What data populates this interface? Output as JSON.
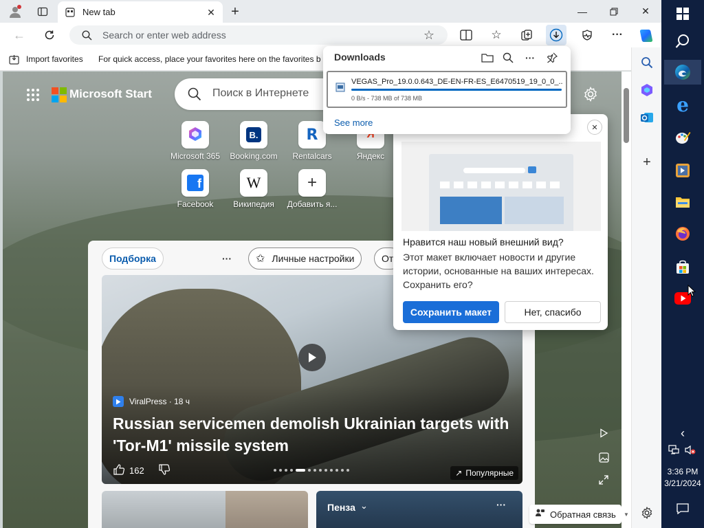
{
  "browser": {
    "tab_title": "New tab",
    "address_placeholder": "Search or enter web address",
    "favorites": {
      "import_label": "Import favorites",
      "hint": "For quick access, place your favorites here on the favorites b"
    }
  },
  "downloads": {
    "title": "Downloads",
    "item": {
      "filename": "VEGAS_Pro_19.0.0.643_DE-EN-FR-ES_E6470519_19_0_0_...",
      "status": "0 B/s - 738 MB of 738 MB",
      "progress": 1.0
    },
    "see_more": "See more"
  },
  "start": {
    "brand": "Microsoft Start",
    "search_placeholder": "Поиск в Интернете",
    "quick_links": [
      {
        "label": "Microsoft 365",
        "icon": "microsoft-365-icon"
      },
      {
        "label": "Booking.com",
        "icon": "booking-icon"
      },
      {
        "label": "Rentalcars",
        "icon": "rentalcars-icon"
      },
      {
        "label": "Яндекс",
        "icon": "yandex-icon"
      },
      {
        "label": "Facebook",
        "icon": "facebook-icon"
      },
      {
        "label": "Википедия",
        "icon": "wikipedia-icon"
      },
      {
        "label": "Добавить я...",
        "icon": "plus-icon"
      }
    ]
  },
  "feed": {
    "tabs": [
      "Подборка",
      "Личные настройки",
      "От"
    ],
    "hero": {
      "source": "ViralPress · 18 ч",
      "title": "Russian servicemen demolish Ukrainian targets with 'Tor-M1' missile system",
      "likes": "162",
      "trending": "Популярные"
    },
    "card2_title": "Пенза"
  },
  "popup": {
    "title": "Нравится наш новый внешний вид?",
    "description": "Этот макет включает новости и другие истории, основанные на ваших интересах. Сохранить его?",
    "save": "Сохранить макет",
    "no_thanks": "Нет, спасибо"
  },
  "feedback": "Обратная связь",
  "clock": {
    "time": "3:36 PM",
    "date": "3/21/2024"
  },
  "colors": {
    "accent": "#1a6ed8",
    "taskbar": "#0f1f3f",
    "progress": "#0067c0"
  }
}
